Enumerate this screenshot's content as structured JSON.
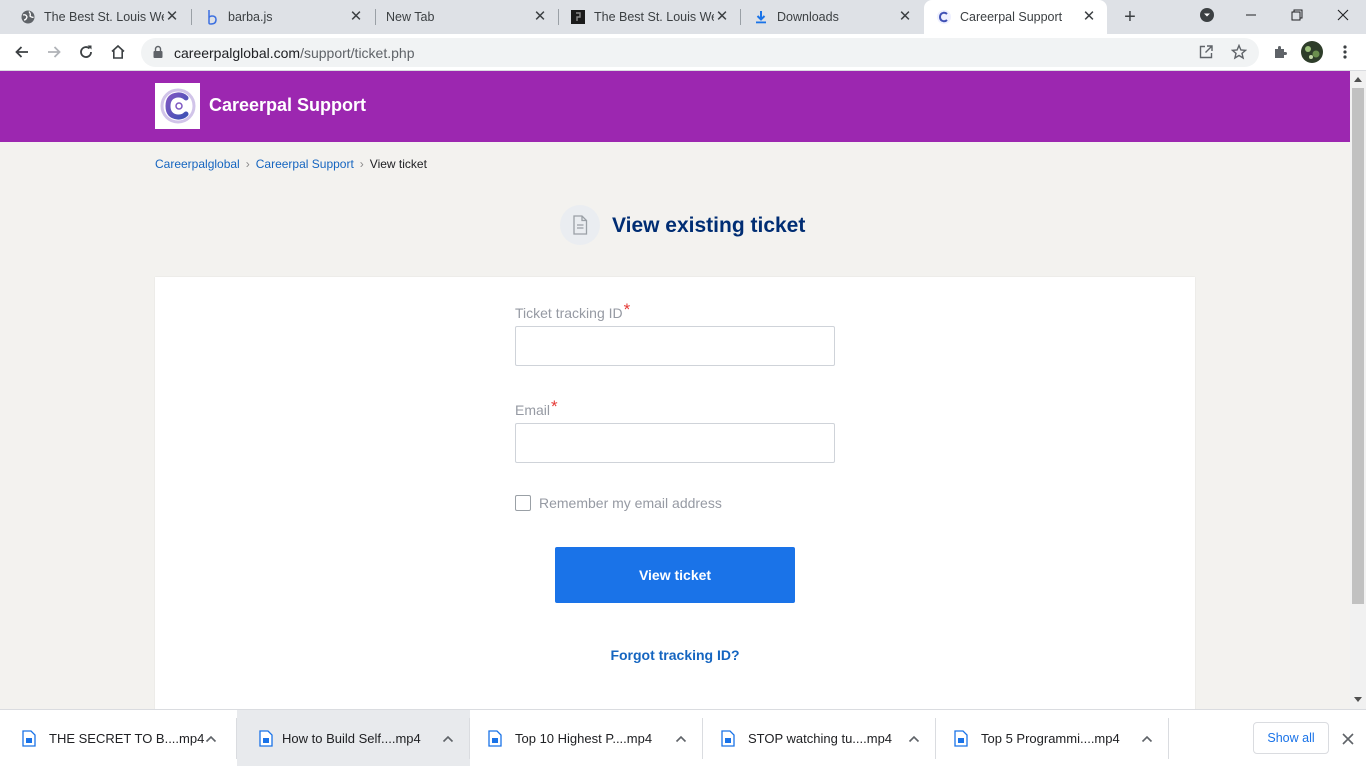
{
  "browser": {
    "tabs": [
      {
        "title": "The Best St. Louis Web",
        "icon": "globe-icon"
      },
      {
        "title": "barba.js",
        "icon": "barba-icon"
      },
      {
        "title": "New Tab",
        "icon": "none"
      },
      {
        "title": "The Best St. Louis Web",
        "icon": "site-dark-icon"
      },
      {
        "title": "Downloads",
        "icon": "download-icon"
      },
      {
        "title": "Careerpal Support",
        "icon": "careerpal-icon",
        "active": true
      }
    ],
    "close_glyph": "✕",
    "new_tab_glyph": "+",
    "url_host": "careerpalglobal.com",
    "url_path": "/support/ticket.php"
  },
  "header": {
    "brand": "Careerpal Support",
    "logo_letter": "C",
    "color": "#9c27b0"
  },
  "breadcrumb": {
    "items": [
      "Careerpalglobal",
      "Careerpal Support"
    ],
    "current": "View ticket",
    "sep": "›"
  },
  "main": {
    "title": "View existing ticket",
    "form": {
      "tracking_label": "Ticket tracking ID",
      "tracking_value": "",
      "email_label": "Email",
      "email_value": "",
      "required_mark": "*",
      "remember_label": "Remember my email address",
      "remember_checked": false,
      "submit_label": "View ticket",
      "forgot_label": "Forgot tracking ID?"
    },
    "accent": "#1a73e8",
    "heading_color": "#002d73"
  },
  "downloads": {
    "items": [
      {
        "name": "THE SECRET TO B....mp4"
      },
      {
        "name": "How to Build Self....mp4"
      },
      {
        "name": "Top 10 Highest P....mp4"
      },
      {
        "name": "STOP watching tu....mp4"
      },
      {
        "name": "Top 5 Programmi....mp4"
      }
    ],
    "show_all": "Show all"
  }
}
